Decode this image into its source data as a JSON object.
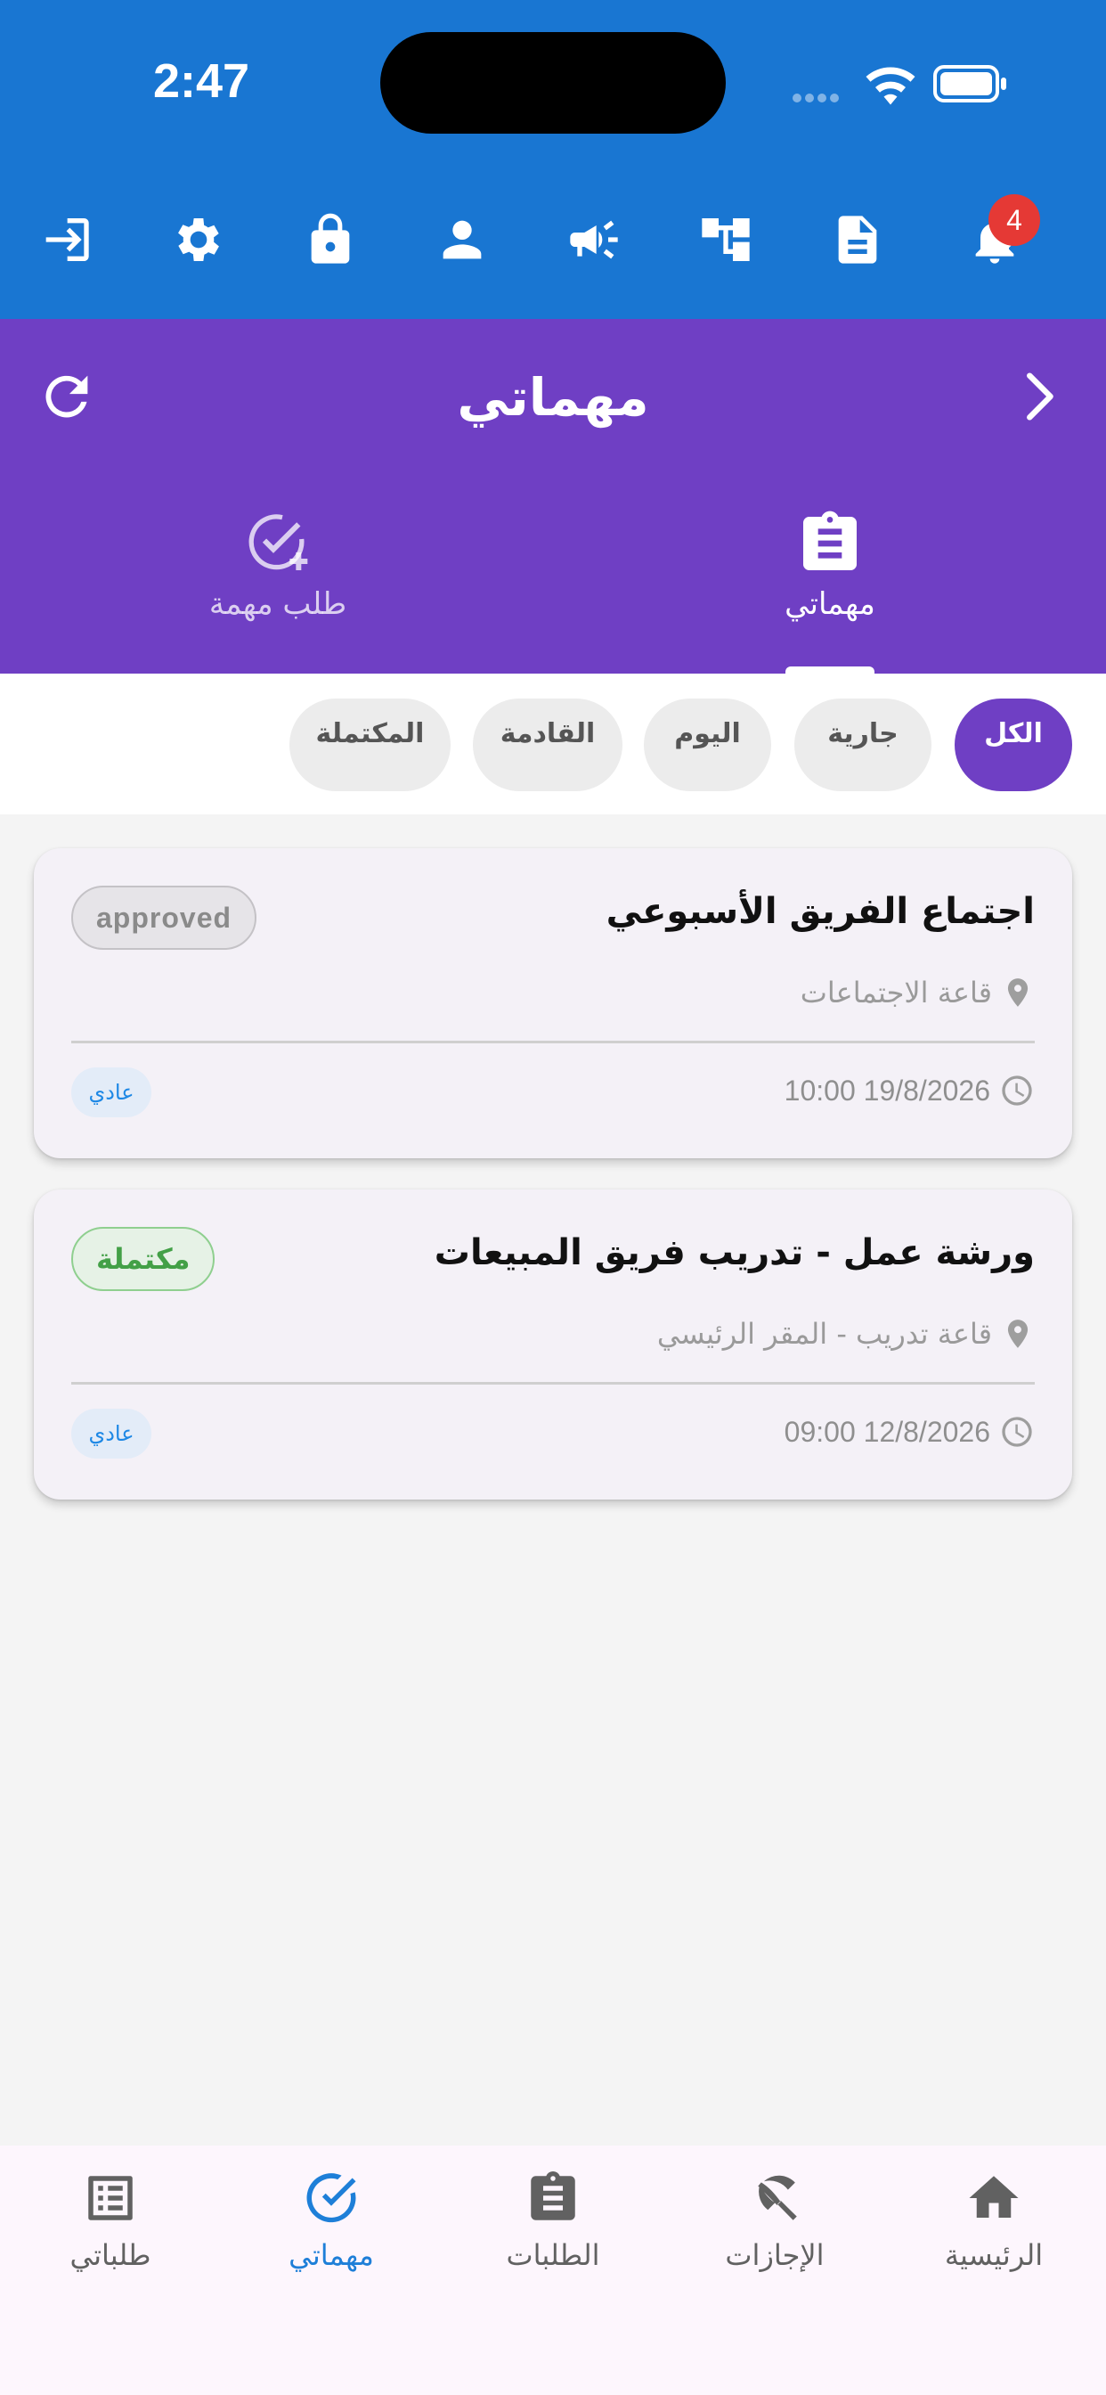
{
  "status_bar": {
    "time": "2:47"
  },
  "toolbar": {
    "icons": [
      "logout-icon",
      "gear-icon",
      "lock-icon",
      "person-icon",
      "megaphone-icon",
      "org-chart-icon",
      "document-icon",
      "notification-bell-icon"
    ],
    "notification_count": "4"
  },
  "header": {
    "title": "مهماتي",
    "tabs": [
      {
        "label": "مهماتي",
        "icon": "clipboard-icon",
        "active": true
      },
      {
        "label": "طلب مهمة",
        "icon": "add-task-icon",
        "active": false
      }
    ]
  },
  "filters": [
    {
      "label": "الكل",
      "active": true
    },
    {
      "label": "جارية",
      "active": false
    },
    {
      "label": "اليوم",
      "active": false
    },
    {
      "label": "القادمة",
      "active": false
    },
    {
      "label": "المكتملة",
      "active": false
    }
  ],
  "tasks": [
    {
      "title": "اجتماع الفريق الأسبوعي",
      "status": "approved",
      "location": "قاعة الاجتماعات",
      "datetime": "10:00 19/8/2026",
      "priority": "عادي"
    },
    {
      "title": "ورشة عمل - تدريب فريق المبيعات",
      "status": "مكتملة",
      "location": "قاعة تدريب - المقر الرئيسي",
      "datetime": "09:00 12/8/2026",
      "priority": "عادي"
    }
  ],
  "bottom_nav": [
    {
      "label": "الرئيسية",
      "icon": "home-icon",
      "active": false
    },
    {
      "label": "الإجازات",
      "icon": "beach-umbrella-icon",
      "active": false
    },
    {
      "label": "الطلبات",
      "icon": "clipboard-icon",
      "active": false
    },
    {
      "label": "مهماتي",
      "icon": "check-circle-icon",
      "active": true
    },
    {
      "label": "طلباتي",
      "icon": "list-icon",
      "active": false
    }
  ],
  "colors": {
    "blue_header": "#1976d2",
    "purple_header": "#6f3fc4",
    "active_nav": "#1e7fd8",
    "badge_red": "#e53935",
    "completed_green": "#43a047"
  }
}
